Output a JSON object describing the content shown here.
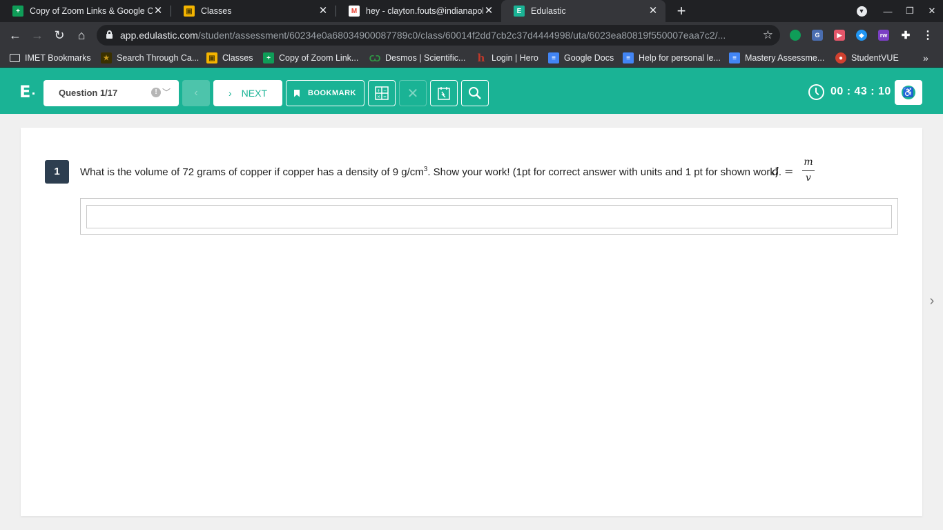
{
  "tabs": [
    {
      "label": "Copy of Zoom Links & Google Cl",
      "favicon_color": "#0f9d58",
      "favicon_glyph": "+"
    },
    {
      "label": "Classes",
      "favicon_color": "#f4b400",
      "favicon_glyph": "▣"
    },
    {
      "label": "hey - clayton.fouts@indianapolis",
      "favicon_color": "#ea4335",
      "favicon_glyph": "M"
    },
    {
      "label": "Edulastic",
      "favicon_color": "#1ab395",
      "favicon_glyph": "E"
    }
  ],
  "address_bar": {
    "host": "app.edulastic.com",
    "path": "/student/assessment/60234e0a68034900087789c0/class/60014f2dd7cb2c37d4444998/uta/6023ea80819f550007eaa7c2/..."
  },
  "bookmarks": [
    {
      "label": "IMET Bookmarks",
      "icon": "folder-icon",
      "color": "#e8eaed"
    },
    {
      "label": "Search Through Ca...",
      "icon": "star-icon",
      "color": "#c79a1f"
    },
    {
      "label": "Classes",
      "icon": "classroom-icon",
      "color": "#f4b400"
    },
    {
      "label": "Copy of Zoom Link...",
      "icon": "sheets-icon",
      "color": "#0f9d58"
    },
    {
      "label": "Desmos | Scientific...",
      "icon": "desmos-icon",
      "color": "#2f9a45"
    },
    {
      "label": "Login | Hero",
      "icon": "hero-icon",
      "color": "#c0392b"
    },
    {
      "label": "Google Docs",
      "icon": "docs-icon",
      "color": "#4285f4"
    },
    {
      "label": "Help for personal le...",
      "icon": "docs-icon",
      "color": "#4285f4"
    },
    {
      "label": "Mastery Assessme...",
      "icon": "docs-icon",
      "color": "#4285f4"
    },
    {
      "label": "StudentVUE",
      "icon": "studentvue-icon",
      "color": "#d0402f"
    }
  ],
  "app_header": {
    "logo": "E",
    "question_selector": "Question 1/17",
    "next_label": "NEXT",
    "bookmark_label": "BOOKMARK",
    "timer": "00 : 43 : 10",
    "accent_color": "#1ab395"
  },
  "question": {
    "number": "1",
    "text_before_sup": "What is the volume of 72 grams of copper if copper has a density of 9 g/cm",
    "sup": "3",
    "text_after_sup": ". Show your work! (1pt for correct answer with units and 1 pt for shown work).",
    "formula": {
      "lhs": "d",
      "eq": "=",
      "numerator": "m",
      "denominator": "v"
    },
    "answer_value": ""
  }
}
